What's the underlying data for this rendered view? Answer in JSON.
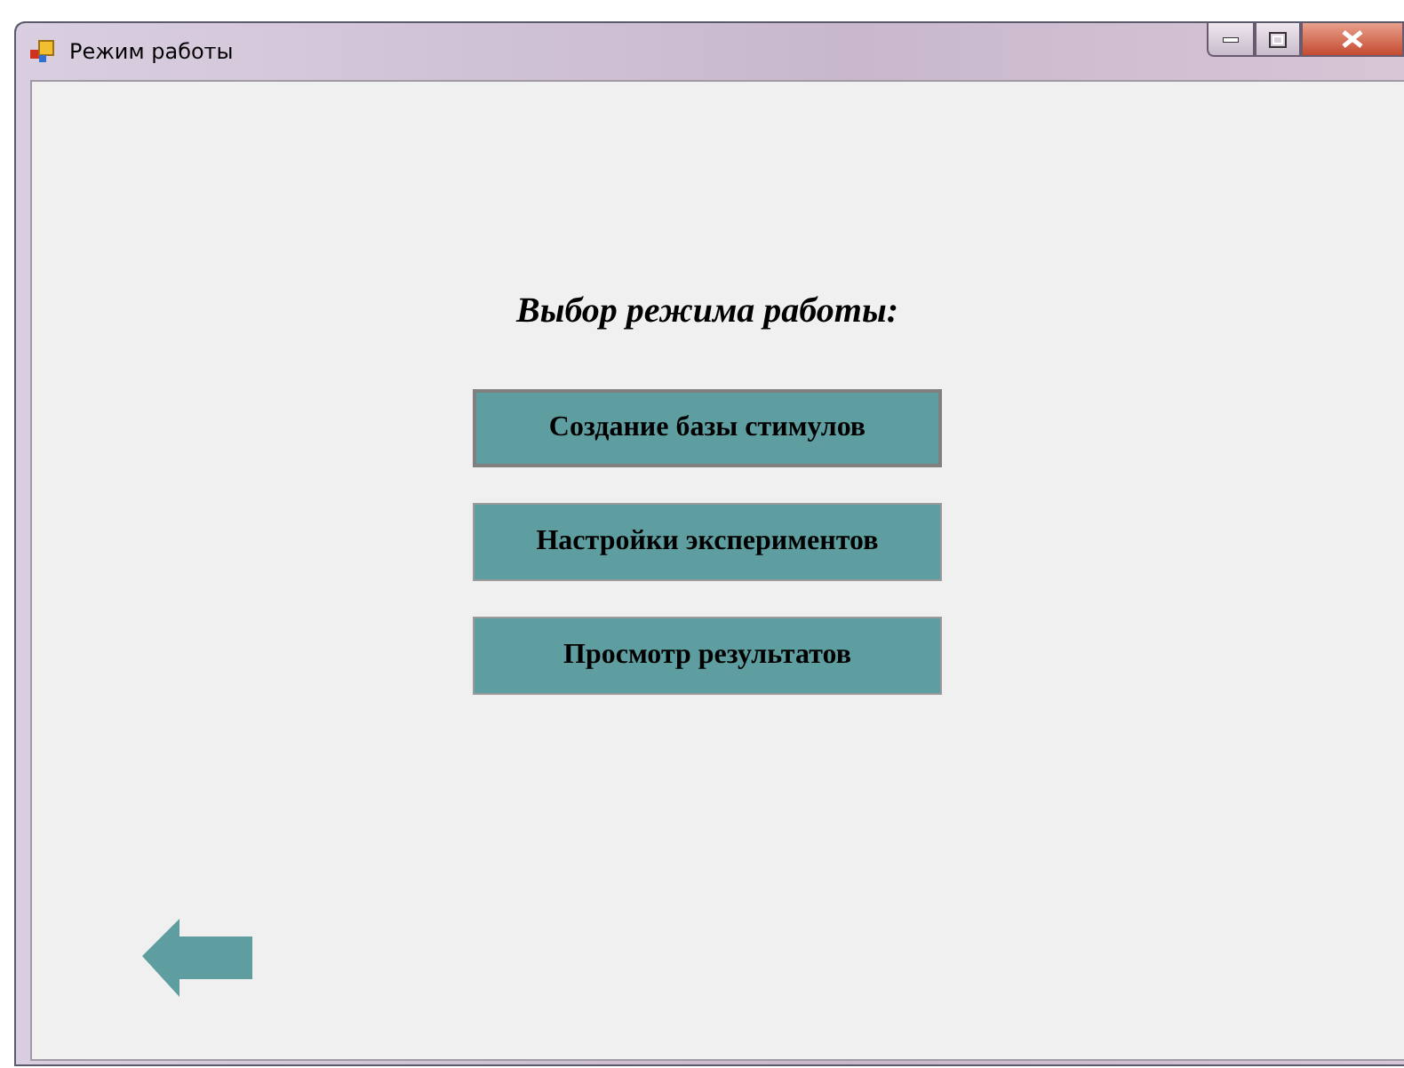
{
  "window": {
    "title": "Режим работы"
  },
  "heading": "Выбор режима работы:",
  "buttons": [
    {
      "label": "Создание базы стимулов",
      "focused": true
    },
    {
      "label": "Настройки экспериментов",
      "focused": false
    },
    {
      "label": "Просмотр результатов",
      "focused": false
    }
  ]
}
